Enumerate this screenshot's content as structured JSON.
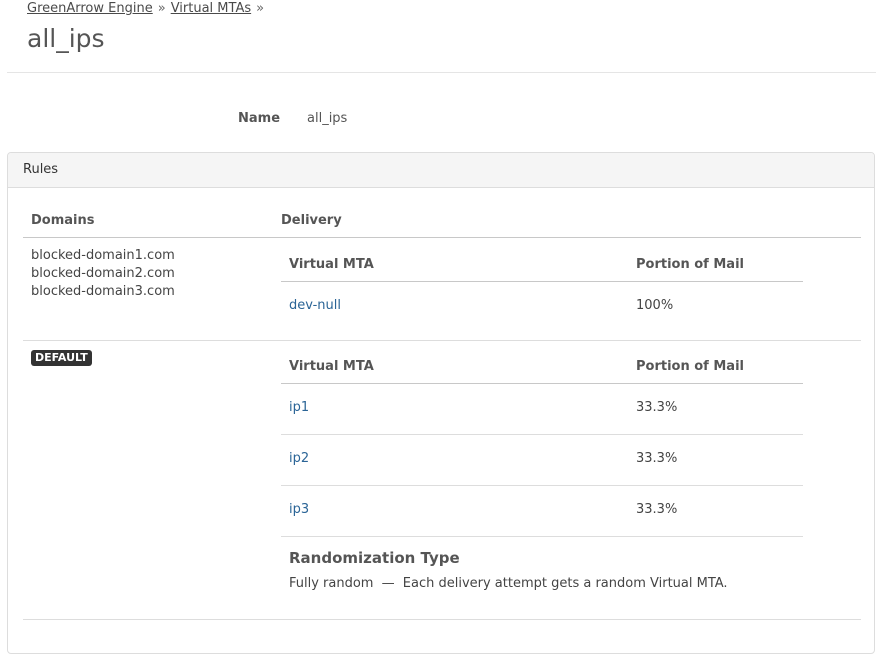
{
  "breadcrumb": {
    "items": [
      "GreenArrow Engine",
      "Virtual MTAs"
    ],
    "separator": "»"
  },
  "page_title": "all_ips",
  "name_field": {
    "label": "Name",
    "value": "all_ips"
  },
  "rules_panel": {
    "heading": "Rules",
    "columns": {
      "domains": "Domains",
      "delivery": "Delivery"
    },
    "rules": [
      {
        "domains": [
          "blocked-domain1.com",
          "blocked-domain2.com",
          "blocked-domain3.com"
        ],
        "delivery_headers": {
          "vmta": "Virtual MTA",
          "portion": "Portion of Mail"
        },
        "deliveries": [
          {
            "vmta": "dev-null",
            "portion": "100%"
          }
        ]
      },
      {
        "badge": "DEFAULT",
        "delivery_headers": {
          "vmta": "Virtual MTA",
          "portion": "Portion of Mail"
        },
        "deliveries": [
          {
            "vmta": "ip1",
            "portion": "33.3%"
          },
          {
            "vmta": "ip2",
            "portion": "33.3%"
          },
          {
            "vmta": "ip3",
            "portion": "33.3%"
          }
        ],
        "randomization": {
          "title": "Randomization Type",
          "type": "Fully random",
          "dash": "—",
          "description": "Each delivery attempt gets a random Virtual MTA."
        }
      }
    ]
  }
}
